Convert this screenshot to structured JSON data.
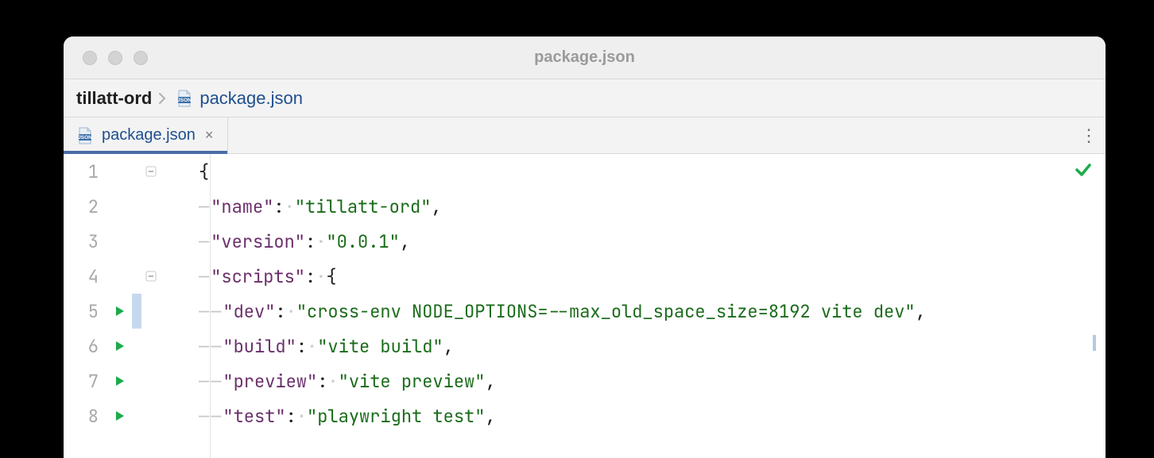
{
  "window": {
    "title": "package.json"
  },
  "breadcrumb": {
    "root": "tillatt-ord",
    "file": "package.json"
  },
  "tab": {
    "label": "package.json",
    "close": "×",
    "menu": "⋮"
  },
  "lines": {
    "l1": {
      "num": "1",
      "tokens": {
        "open": "{"
      }
    },
    "l2": {
      "num": "2",
      "key": "\"name\"",
      "val": "\"tillatt-ord\"",
      "comma": ","
    },
    "l3": {
      "num": "3",
      "key": "\"version\"",
      "val": "\"0.0.1\"",
      "comma": ","
    },
    "l4": {
      "num": "4",
      "key": "\"scripts\"",
      "open": "{"
    },
    "l5": {
      "num": "5",
      "key": "\"dev\"",
      "val": "\"cross-env NODE_OPTIONS=--max_old_space_size=8192 vite dev\"",
      "comma": ","
    },
    "l6": {
      "num": "6",
      "key": "\"build\"",
      "val": "\"vite build\"",
      "comma": ","
    },
    "l7": {
      "num": "7",
      "key": "\"preview\"",
      "val": "\"vite preview\"",
      "comma": ","
    },
    "l8": {
      "num": "8",
      "key": "\"test\"",
      "val": "\"playwright test\"",
      "comma": ","
    }
  },
  "glyph": {
    "colon": ":",
    "dot": "·",
    "dash": "—"
  }
}
